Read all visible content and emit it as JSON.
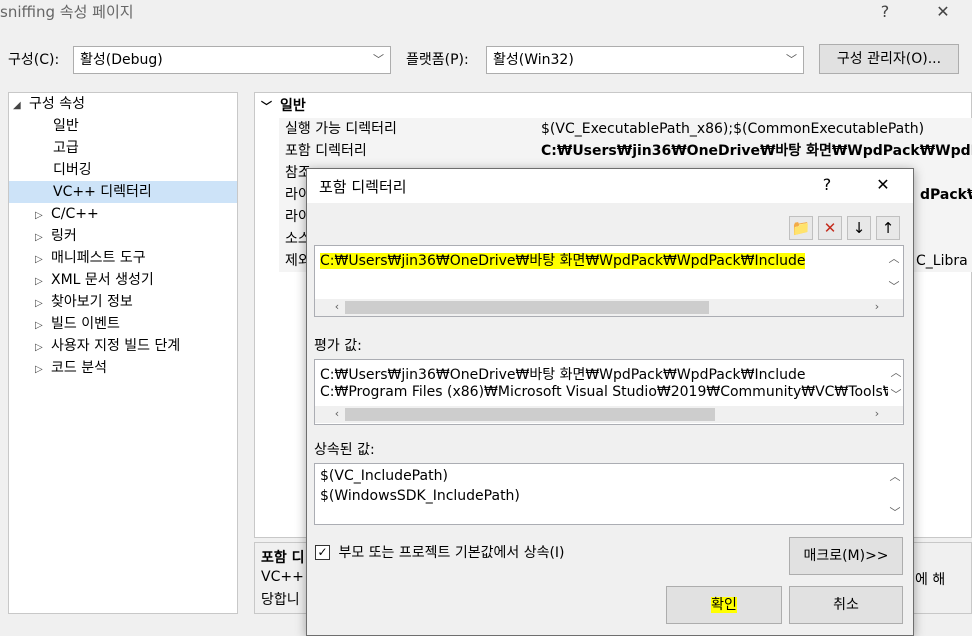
{
  "window": {
    "title": "sniffing 속성 페이지",
    "help": "?",
    "close": "✕"
  },
  "config_bar": {
    "config_label": "구성(C):",
    "config_value": "활성(Debug)",
    "platform_label": "플랫폼(P):",
    "platform_value": "활성(Win32)",
    "manager_button": "구성 관리자(O)..."
  },
  "tree": {
    "root": "구성 속성",
    "items": [
      {
        "label": "일반"
      },
      {
        "label": "고급"
      },
      {
        "label": "디버깅"
      },
      {
        "label": "VC++ 디렉터리"
      },
      {
        "label": "C/C++"
      },
      {
        "label": "링커"
      },
      {
        "label": "매니페스트 도구"
      },
      {
        "label": "XML 문서 생성기"
      },
      {
        "label": "찾아보기 정보"
      },
      {
        "label": "빌드 이벤트"
      },
      {
        "label": "사용자 지정 빌드 단계"
      },
      {
        "label": "코드 분석"
      }
    ]
  },
  "grid": {
    "section": "일반",
    "rows": [
      {
        "name": "실행 가능 디렉터리",
        "value": "$(VC_ExecutablePath_x86);$(CommonExecutablePath)"
      },
      {
        "name": "포함 디렉터리",
        "value": "C:₩Users₩jin36₩OneDrive₩바탕 화면₩WpdPack₩WpdPack₩"
      },
      {
        "name": "참조",
        "value": ""
      },
      {
        "name": "라이",
        "value": "dPack₩"
      },
      {
        "name": "라이",
        "value": ""
      },
      {
        "name": "소스",
        "value": ""
      },
      {
        "name": "제외",
        "value": "C_Libra"
      }
    ]
  },
  "description": {
    "title": "포함 디",
    "line1": "VC++",
    "line2": "당합니",
    "right_text": "에 해"
  },
  "dialog": {
    "title": "포함 디렉터리",
    "help": "?",
    "close": "✕",
    "toolbar": [
      "new-folder",
      "delete",
      "move-down",
      "move-up"
    ],
    "edit_value": "C:₩Users₩jin36₩OneDrive₩바탕 화면₩WpdPack₩WpdPack₩Include",
    "evaluated_label": "평가 값:",
    "evaluated_lines": [
      "C:₩Users₩jin36₩OneDrive₩바탕 화면₩WpdPack₩WpdPack₩Include",
      "C:₩Program Files (x86)₩Microsoft Visual Studio₩2019₩Community₩VC₩Tools₩M"
    ],
    "inherited_label": "상속된 값:",
    "inherited_lines": [
      "$(VC_IncludePath)",
      "$(WindowsSDK_IncludePath)"
    ],
    "inherit_checkbox_label": "부모 또는 프로젝트 기본값에서 상속(I)",
    "inherit_checked": true,
    "macro_button": "매크로(M)>>",
    "ok_button": "확인",
    "cancel_button": "취소"
  },
  "colors": {
    "highlight": "#ffff00",
    "selection": "#cde3f8",
    "delete_red": "#c42b1c"
  }
}
